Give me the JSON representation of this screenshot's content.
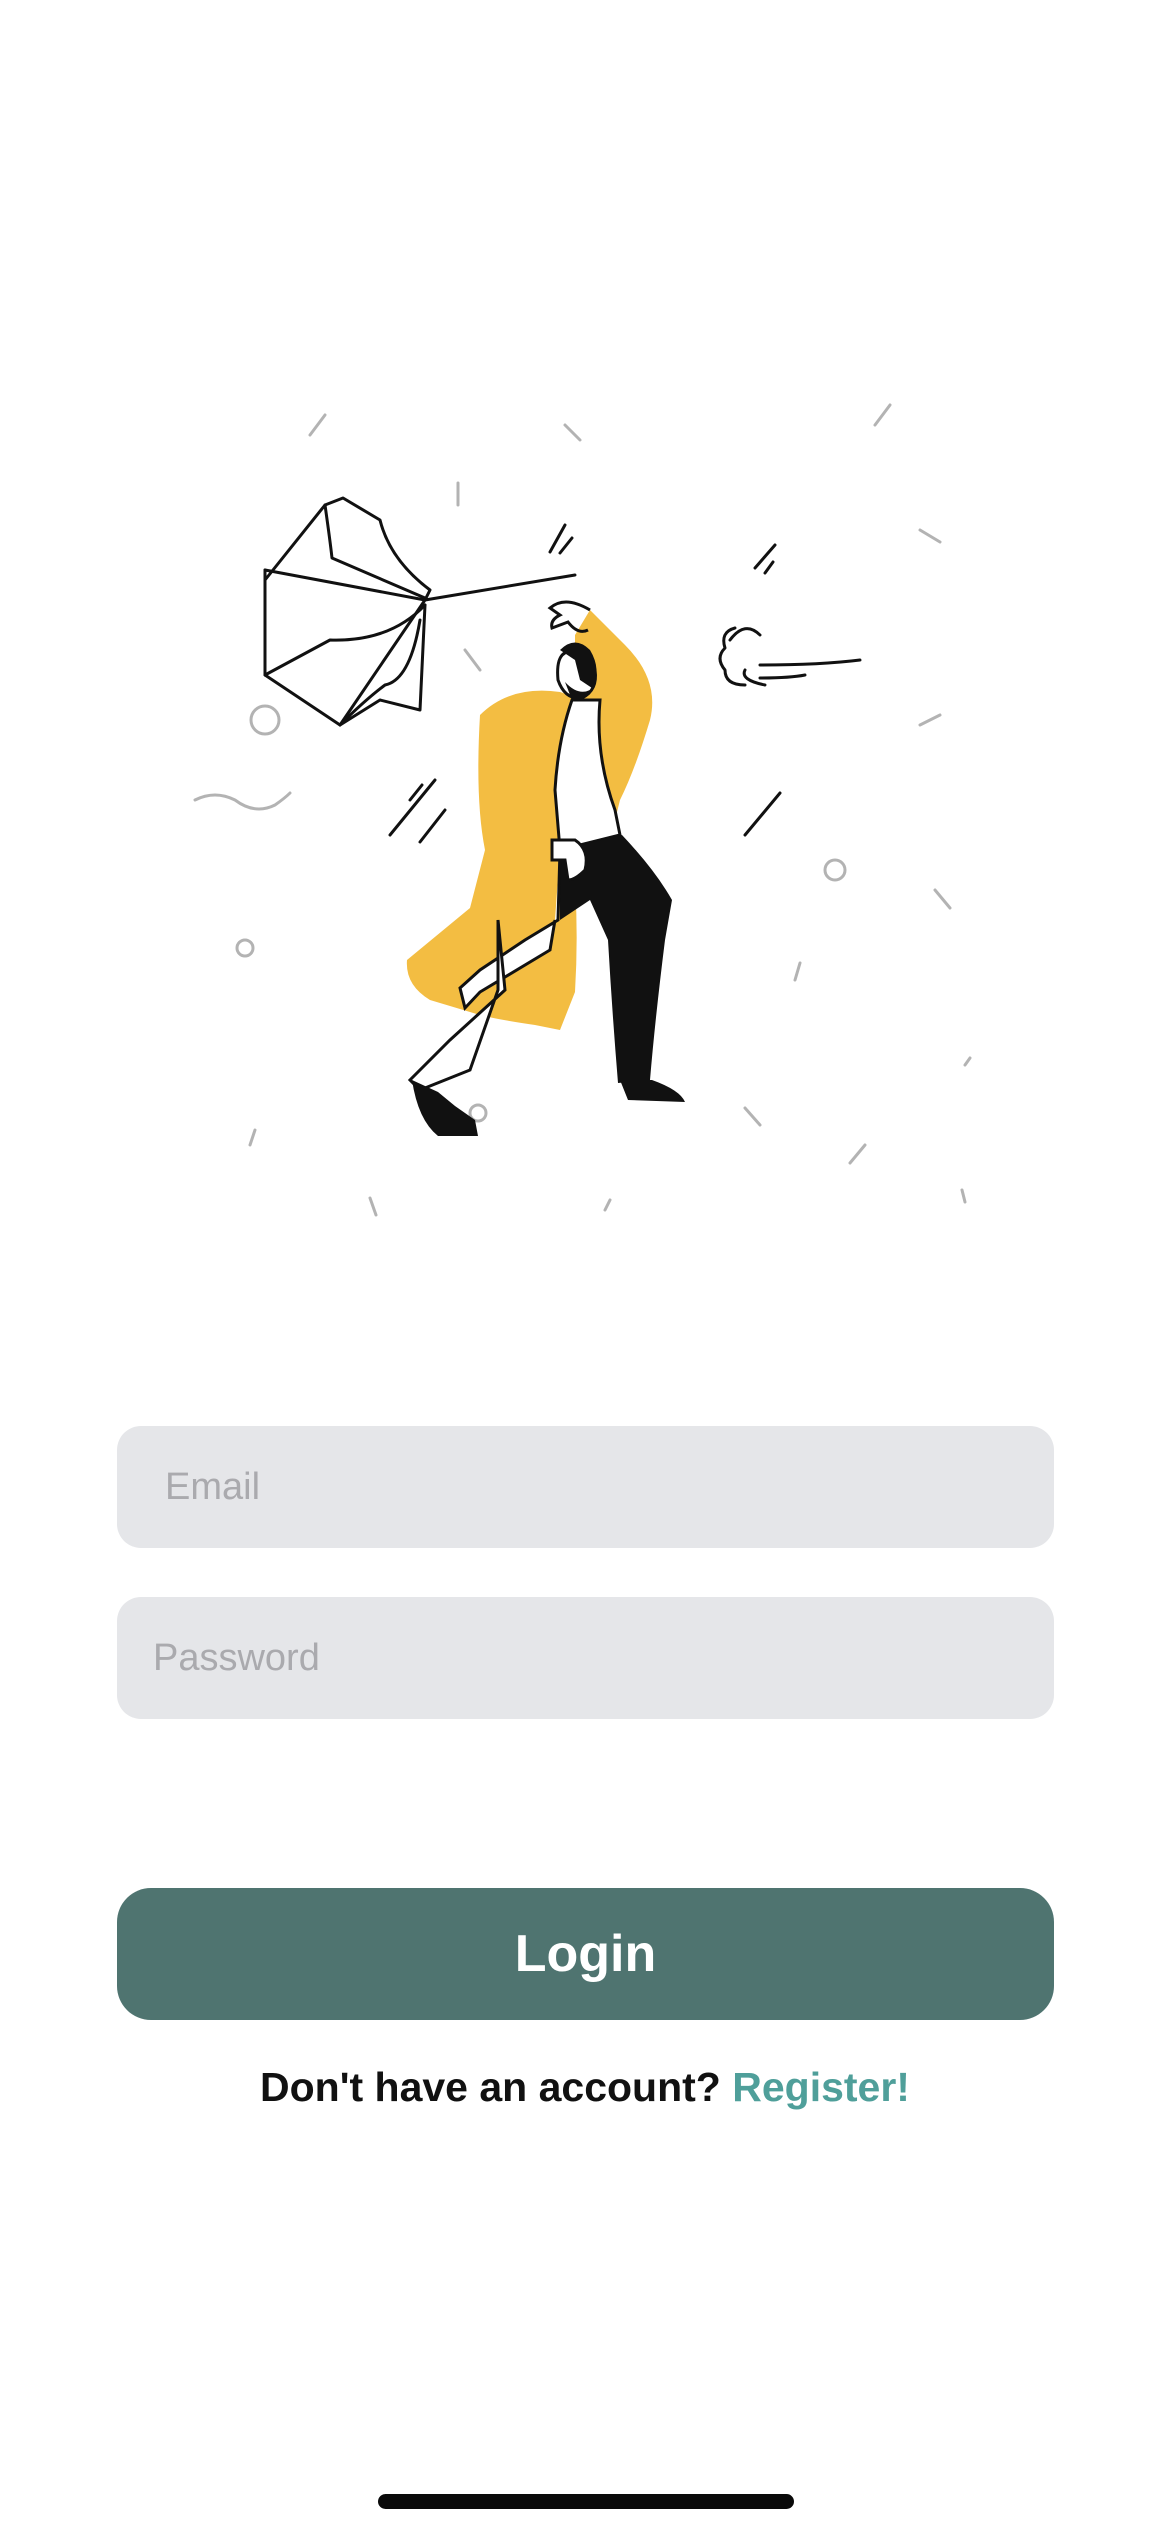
{
  "login_form": {
    "email_placeholder": "Email",
    "password_placeholder": "Password",
    "login_label": "Login"
  },
  "register_prompt": {
    "question": "Don't have an account?",
    "link_label": "Register!"
  },
  "illustration": {
    "icon": "man-with-broken-umbrella-illustration"
  },
  "colors": {
    "accent": "#4f7470",
    "link": "#4f9f9a",
    "field_background": "#e5e6e9",
    "coat": "#f3bd42"
  }
}
